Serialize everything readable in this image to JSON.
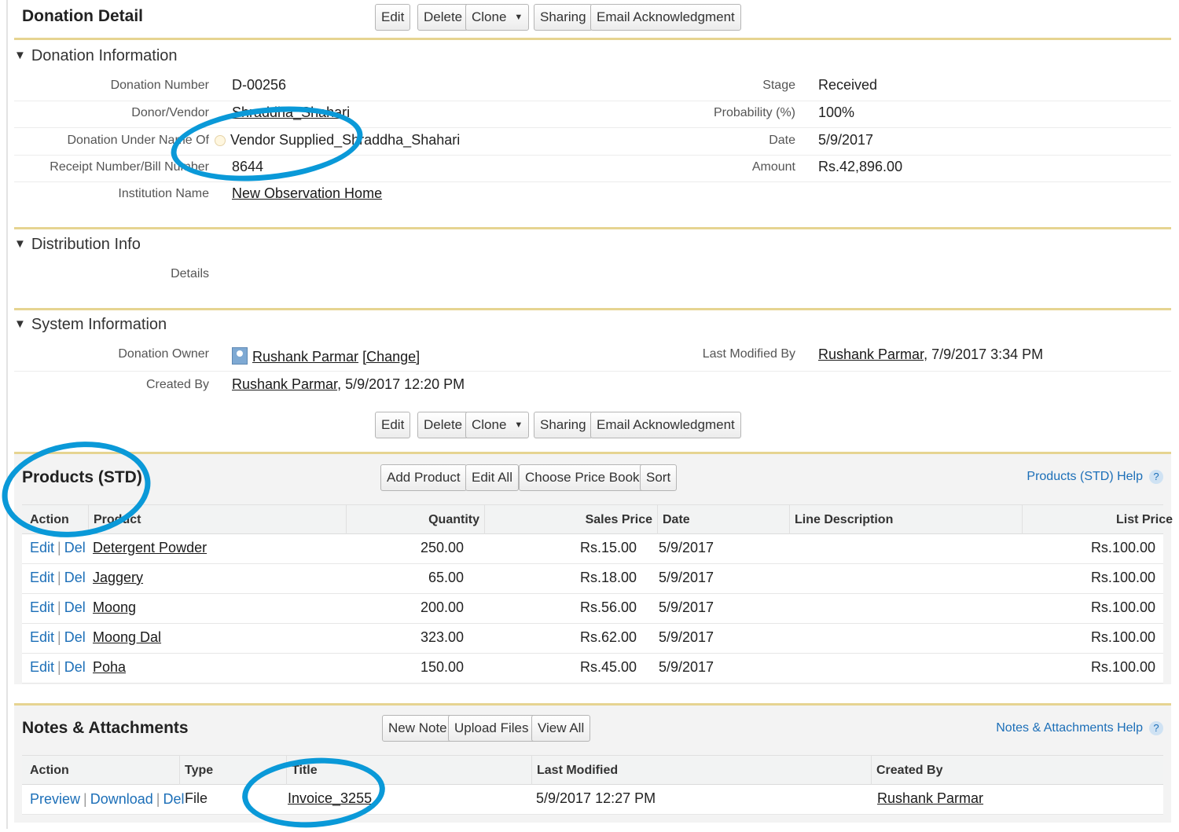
{
  "header": {
    "title": "Donation Detail",
    "buttons": {
      "edit": "Edit",
      "delete": "Delete",
      "clone": "Clone",
      "sharing": "Sharing",
      "email": "Email Acknowledgment"
    }
  },
  "donation_info": {
    "section_title": "Donation Information",
    "fields": {
      "donation_number_label": "Donation Number",
      "donation_number": "D-00256",
      "donor_label": "Donor/Vendor",
      "donor": "Shraddha_Shahari",
      "under_name_label": "Donation Under Name Of",
      "under_name": "Vendor Supplied_Shraddha_Shahari",
      "receipt_label": "Receipt Number/Bill Number",
      "receipt": "8644",
      "institution_label": "Institution Name",
      "institution": "New Observation Home",
      "stage_label": "Stage",
      "stage": "Received",
      "probability_label": "Probability (%)",
      "probability": "100%",
      "date_label": "Date",
      "date": "5/9/2017",
      "amount_label": "Amount",
      "amount": "Rs.42,896.00"
    }
  },
  "distribution_info": {
    "section_title": "Distribution Info",
    "details_label": "Details"
  },
  "system_info": {
    "section_title": "System Information",
    "owner_label": "Donation Owner",
    "owner": "Rushank Parmar",
    "change": "[Change]",
    "created_label": "Created By",
    "created_by": "Rushank Parmar",
    "created_at": ", 5/9/2017 12:20 PM",
    "modified_label": "Last Modified By",
    "modified_by": "Rushank Parmar",
    "modified_at": ", 7/9/2017 3:34 PM"
  },
  "products": {
    "title": "Products (STD)",
    "buttons": {
      "add": "Add Product",
      "edit_all": "Edit All",
      "price_book": "Choose Price Book",
      "sort": "Sort"
    },
    "help": "Products (STD) Help",
    "columns": [
      "Action",
      "Product",
      "Quantity",
      "Sales Price",
      "Date",
      "Line Description",
      "List Price"
    ],
    "action_edit": "Edit",
    "action_del": "Del",
    "rows": [
      {
        "product": "Detergent Powder",
        "quantity": "250.00",
        "sales_price": "Rs.15.00",
        "date": "5/9/2017",
        "line_description": "",
        "list_price": "Rs.100.00"
      },
      {
        "product": "Jaggery",
        "quantity": "65.00",
        "sales_price": "Rs.18.00",
        "date": "5/9/2017",
        "line_description": "",
        "list_price": "Rs.100.00"
      },
      {
        "product": "Moong",
        "quantity": "200.00",
        "sales_price": "Rs.56.00",
        "date": "5/9/2017",
        "line_description": "",
        "list_price": "Rs.100.00"
      },
      {
        "product": "Moong Dal",
        "quantity": "323.00",
        "sales_price": "Rs.62.00",
        "date": "5/9/2017",
        "line_description": "",
        "list_price": "Rs.100.00"
      },
      {
        "product": "Poha",
        "quantity": "150.00",
        "sales_price": "Rs.45.00",
        "date": "5/9/2017",
        "line_description": "",
        "list_price": "Rs.100.00"
      }
    ]
  },
  "notes": {
    "title": "Notes & Attachments",
    "buttons": {
      "new_note": "New Note",
      "upload": "Upload Files",
      "view_all": "View All"
    },
    "help": "Notes & Attachments Help",
    "columns": [
      "Action",
      "Type",
      "Title",
      "Last Modified",
      "Created By"
    ],
    "actions": {
      "preview": "Preview",
      "download": "Download",
      "del": "Del"
    },
    "rows": [
      {
        "type": "File",
        "title": "Invoice_3255",
        "last_modified": "5/9/2017 12:27 PM",
        "created_by": "Rushank Parmar"
      }
    ]
  },
  "colors": {
    "accent_gold": "#e6d491",
    "link_blue": "#1c6fb8",
    "annotation_circle": "#0a99d8"
  }
}
